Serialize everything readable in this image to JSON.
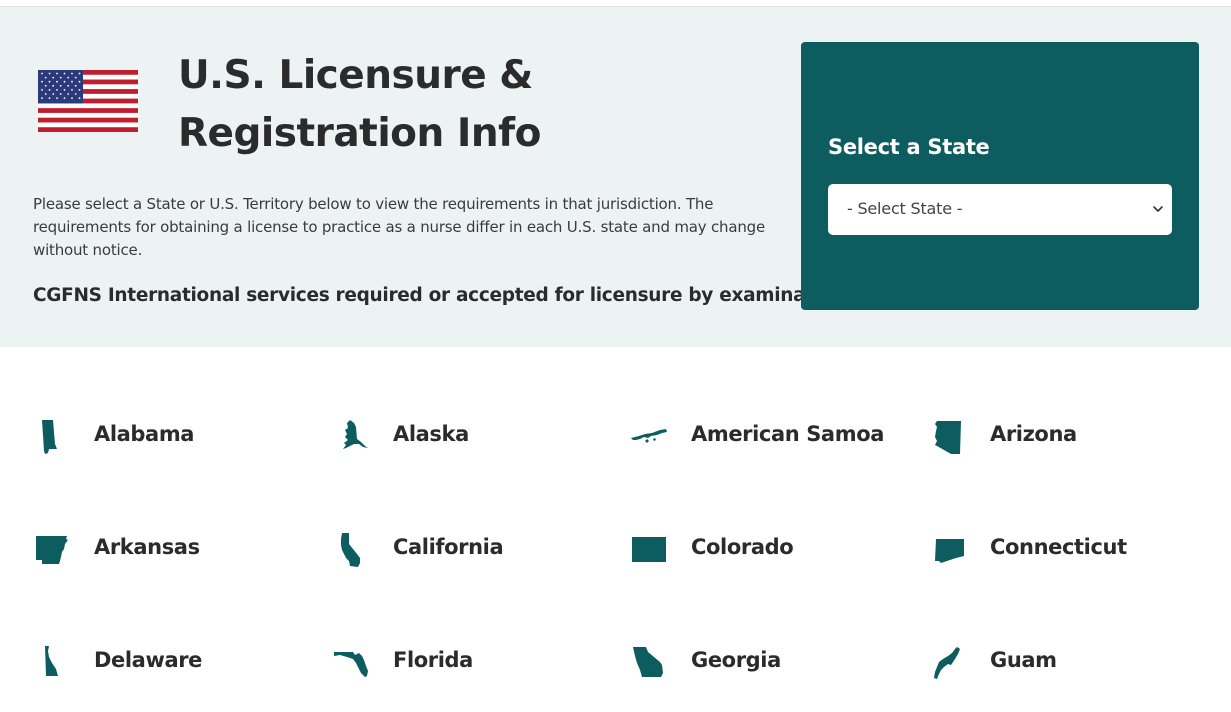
{
  "header": {
    "title": "U.S. Licensure & Registration Info",
    "intro": "Please select a State or U.S. Territory below to view the requirements in that jurisdiction. The requirements for obtaining a license to practice as a nurse differ in each U.S. state and may change without notice.",
    "services_heading": "CGFNS International services required or accepted for licensure by examination"
  },
  "state_select": {
    "heading": "Select a State",
    "selected": "- Select State -"
  },
  "states": [
    {
      "label": "Alabama",
      "icon": "alabama-icon"
    },
    {
      "label": "Alaska",
      "icon": "alaska-icon"
    },
    {
      "label": "American Samoa",
      "icon": "american-samoa-icon"
    },
    {
      "label": "Arizona",
      "icon": "arizona-icon"
    },
    {
      "label": "Arkansas",
      "icon": "arkansas-icon"
    },
    {
      "label": "California",
      "icon": "california-icon"
    },
    {
      "label": "Colorado",
      "icon": "colorado-icon"
    },
    {
      "label": "Connecticut",
      "icon": "connecticut-icon"
    },
    {
      "label": "Delaware",
      "icon": "delaware-icon"
    },
    {
      "label": "Florida",
      "icon": "florida-icon"
    },
    {
      "label": "Georgia",
      "icon": "georgia-icon"
    },
    {
      "label": "Guam",
      "icon": "guam-icon"
    }
  ],
  "colors": {
    "hero_background": "#edf3f3",
    "accent": "#0d5c5f",
    "text": "#2b2b2b"
  }
}
